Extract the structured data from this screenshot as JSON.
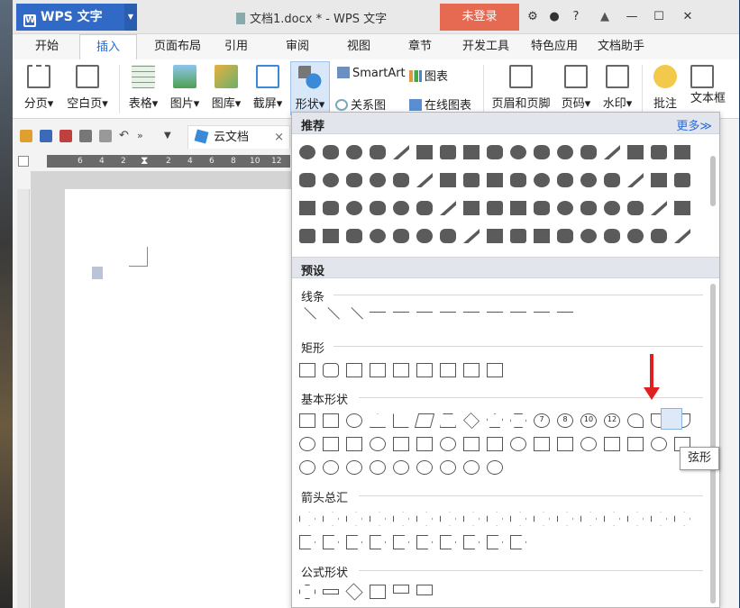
{
  "app": {
    "logo": "WPS 文字",
    "title": "文档1.docx * - WPS 文字",
    "login_button": "未登录"
  },
  "menus": [
    "开始",
    "插入",
    "页面布局",
    "引用",
    "审阅",
    "视图",
    "章节",
    "开发工具",
    "特色应用",
    "文档助手"
  ],
  "ribbon": {
    "cover_page": "分页",
    "blank_page": "空白页",
    "table": "表格",
    "picture": "图片",
    "gallery": "图库",
    "screenshot": "截屏",
    "shapes": "形状",
    "smartart": "SmartArt",
    "chart": "图表",
    "relation_chart": "关系图",
    "online_chart": "在线图表",
    "header_footer": "页眉和页脚",
    "page_number": "页码",
    "watermark": "水印",
    "comment": "批注",
    "textbox": "文本框"
  },
  "toolbar": {
    "cloud_tab": "云文档",
    "close": "×"
  },
  "ruler_numbers": [
    "6",
    "4",
    "2",
    "2",
    "4",
    "6",
    "8",
    "10",
    "12"
  ],
  "shapes_panel": {
    "recommended": "推荐",
    "more": "更多≫",
    "preset": "预设",
    "sections": {
      "lines": "线条",
      "rectangles": "矩形",
      "basic_shapes": "基本形状",
      "arrows": "箭头总汇",
      "formula": "公式形状"
    },
    "basic_labels": [
      "7",
      "8",
      "10",
      "12"
    ],
    "tooltip": "弦形"
  }
}
